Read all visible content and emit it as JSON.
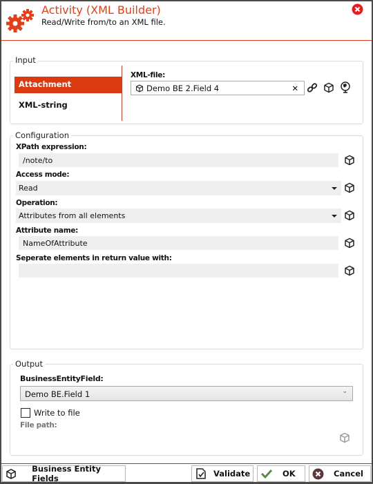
{
  "header": {
    "title": "Activity (XML Builder)",
    "subtitle": "Read/Write from/to an XML file."
  },
  "input": {
    "legend": "Input",
    "tabs": [
      {
        "label": "Attachment",
        "active": true
      },
      {
        "label": "XML-string",
        "active": false
      }
    ],
    "xml_file_label": "XML-file:",
    "xml_file_value": "Demo BE 2.Field 4"
  },
  "configuration": {
    "legend": "Configuration",
    "xpath_label": "XPath expression:",
    "xpath_value": "/note/to",
    "access_label": "Access mode:",
    "access_value": "Read",
    "operation_label": "Operation:",
    "operation_value": "Attributes from all elements",
    "attribute_label": "Attribute name:",
    "attribute_value": "NameOfAttribute",
    "separator_label": "Seperate elements in return value with:",
    "separator_value": ""
  },
  "output": {
    "legend": "Output",
    "bef_label": "BusinessEntityField:",
    "bef_value": "Demo BE.Field 1",
    "write_to_file_label": "Write to file",
    "write_to_file_checked": false,
    "file_path_label": "File path:"
  },
  "footer": {
    "business_entity_fields": "Business Entity Fields",
    "validate": "Validate",
    "ok": "OK",
    "cancel": "Cancel"
  },
  "colors": {
    "accent": "#e0401a",
    "tab_active": "#d93a10",
    "ok_check": "#5a8a4a",
    "cancel_icon": "#5a3a3a"
  }
}
